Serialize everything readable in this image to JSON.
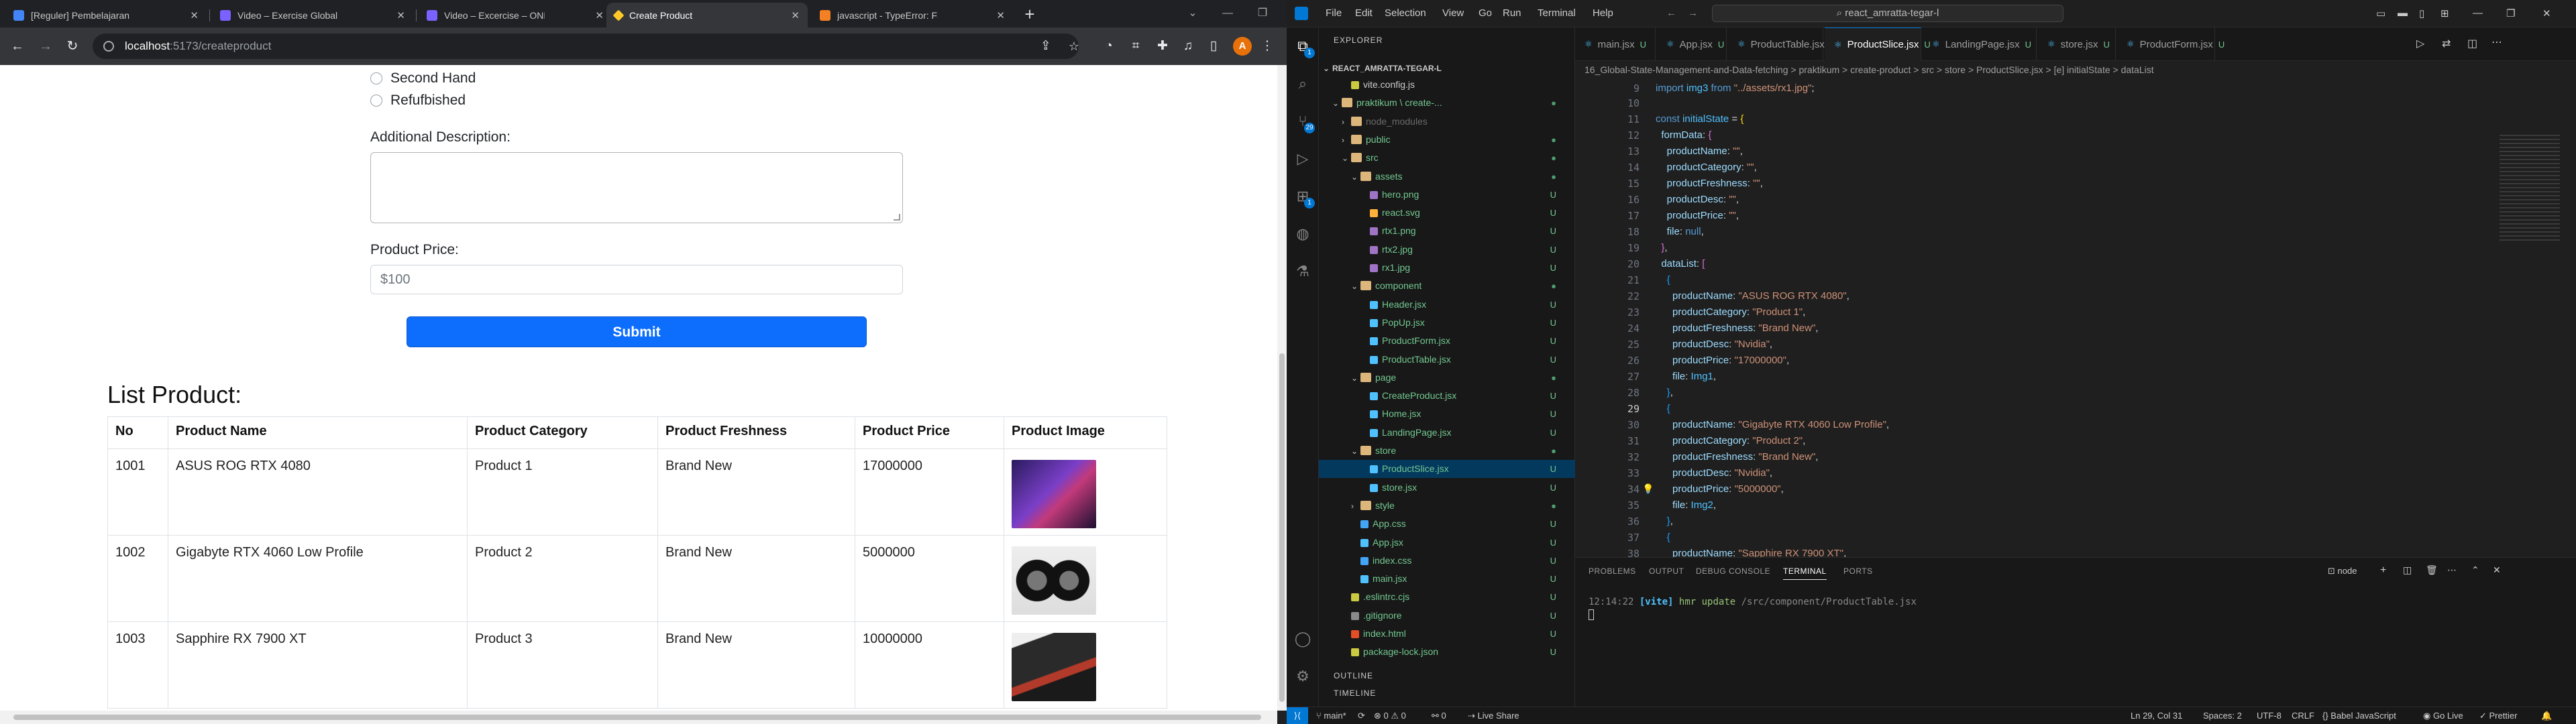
{
  "browser": {
    "tabs": [
      {
        "title": "[Reguler] Pembelajaran Teknis M",
        "favicon_color": "#4285f4",
        "active": false
      },
      {
        "title": "Video – Exercise Global State M",
        "favicon_color": "#7b61ff",
        "active": false
      },
      {
        "title": "Video – Excercise – ONE by Alte",
        "favicon_color": "#7b61ff",
        "active": false
      },
      {
        "title": "Create Product",
        "favicon_color": "#ffca28",
        "active": true
      },
      {
        "title": "javascript - TypeError: Failed to",
        "favicon_color": "#f48024",
        "active": false
      }
    ],
    "url_host": "localhost",
    "url_path": ":5173/createproduct",
    "profile_initial": "A"
  },
  "page": {
    "condition_options": [
      "Second Hand",
      "Refufbished"
    ],
    "desc_label": "Additional Description:",
    "price_label": "Product Price:",
    "price_placeholder": "$100",
    "submit_label": "Submit",
    "list_title": "List Product:",
    "table": {
      "headers": [
        "No",
        "Product Name",
        "Product Category",
        "Product Freshness",
        "Product Price",
        "Product Image"
      ],
      "rows": [
        {
          "no": "1001",
          "name": "ASUS ROG RTX 4080",
          "category": "Product 1",
          "freshness": "Brand New",
          "price": "17000000",
          "image_color": "#5b3fa0"
        },
        {
          "no": "1002",
          "name": "Gigabyte RTX 4060 Low Profile",
          "category": "Product 2",
          "freshness": "Brand New",
          "price": "5000000",
          "image_color": "#2b2b2b"
        },
        {
          "no": "1003",
          "name": "Sapphire RX 7900 XT",
          "category": "Product 3",
          "freshness": "Brand New",
          "price": "10000000",
          "image_color": "#3a2a2a"
        }
      ]
    }
  },
  "vscode": {
    "menu": [
      "File",
      "Edit",
      "Selection",
      "View",
      "Go",
      "Run",
      "Terminal",
      "Help"
    ],
    "command_center": "react_amratta-tegar-l",
    "explorer": {
      "header": "EXPLORER",
      "root": "REACT_AMRATTA-TEGAR-L",
      "items": [
        {
          "label": "vite.config.js",
          "status": ""
        },
        {
          "label": "praktikum \\ create-...",
          "status": "●"
        },
        {
          "label": "node_modules",
          "status": ""
        },
        {
          "label": "public",
          "status": "●"
        },
        {
          "label": "src",
          "status": "●"
        },
        {
          "label": "assets",
          "status": "●"
        },
        {
          "label": "hero.png",
          "status": "U"
        },
        {
          "label": "react.svg",
          "status": "U"
        },
        {
          "label": "rtx1.png",
          "status": "U"
        },
        {
          "label": "rtx2.jpg",
          "status": "U"
        },
        {
          "label": "rx1.jpg",
          "status": "U"
        },
        {
          "label": "component",
          "status": "●"
        },
        {
          "label": "Header.jsx",
          "status": "U"
        },
        {
          "label": "PopUp.jsx",
          "status": "U"
        },
        {
          "label": "ProductForm.jsx",
          "status": "U"
        },
        {
          "label": "ProductTable.jsx",
          "status": "U"
        },
        {
          "label": "page",
          "status": "●"
        },
        {
          "label": "CreateProduct.jsx",
          "status": "U"
        },
        {
          "label": "Home.jsx",
          "status": "U"
        },
        {
          "label": "LandingPage.jsx",
          "status": "U"
        },
        {
          "label": "store",
          "status": "●"
        },
        {
          "label": "ProductSlice.jsx",
          "status": "U"
        },
        {
          "label": "store.jsx",
          "status": "U"
        },
        {
          "label": "style",
          "status": "●"
        },
        {
          "label": "App.css",
          "status": "U"
        },
        {
          "label": "App.jsx",
          "status": "U"
        },
        {
          "label": "index.css",
          "status": "U"
        },
        {
          "label": "main.jsx",
          "status": "U"
        },
        {
          "label": ".eslintrc.cjs",
          "status": "U"
        },
        {
          "label": ".gitignore",
          "status": "U"
        },
        {
          "label": "index.html",
          "status": "U"
        },
        {
          "label": "package-lock.json",
          "status": "U"
        }
      ],
      "outline": "OUTLINE",
      "timeline": "TIMELINE"
    },
    "editor_tabs": [
      {
        "label": "main.jsx",
        "status": "U"
      },
      {
        "label": "App.jsx",
        "status": "U"
      },
      {
        "label": "ProductTable.jsx",
        "status": "U"
      },
      {
        "label": "ProductSlice.jsx",
        "status": "U"
      },
      {
        "label": "LandingPage.jsx",
        "status": "U"
      },
      {
        "label": "store.jsx",
        "status": "U"
      },
      {
        "label": "ProductForm.jsx",
        "status": "U"
      }
    ],
    "breadcrumb": "16_Global-State-Management-and-Data-fetching > praktikum > create-product > src > store > ProductSlice.jsx > [e] initialState > dataList",
    "first_line": "9",
    "panel_tabs": [
      "PROBLEMS",
      "OUTPUT",
      "DEBUG CONSOLE",
      "TERMINAL",
      "PORTS"
    ],
    "terminal_shell": "node",
    "terminal_time": "12:14:22",
    "terminal_tag": "[vite]",
    "terminal_msg": "hmr update",
    "terminal_path": "/src/component/ProductTable.jsx",
    "status": {
      "branch": "main*",
      "errors": "⊗ 0 ⚠ 0",
      "ports": "0",
      "live_share": "Live Share",
      "position": "Ln 29, Col 31",
      "spaces": "Spaces: 2",
      "encoding": "UTF-8",
      "eol": "CRLF",
      "language": "Babel JavaScript",
      "golive": "Go Live",
      "prettier": "Prettier"
    }
  }
}
